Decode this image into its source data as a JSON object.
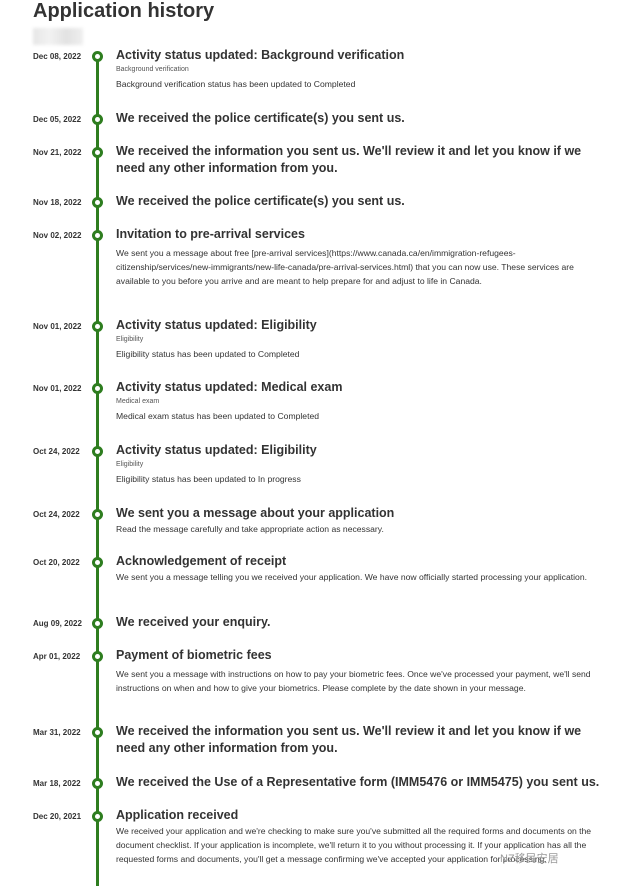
{
  "page": {
    "title": "Application history",
    "watermark": "NZ移民安居"
  },
  "colors": {
    "accent": "#2e7d1f",
    "text": "#333333"
  },
  "events": [
    {
      "date": "Dec 08, 2022",
      "title": "Activity status updated: Background verification",
      "subtitle": "Background verification",
      "description": "Background verification status has been updated to Completed"
    },
    {
      "date": "Dec 05, 2022",
      "title": "We received the police certificate(s) you sent us.",
      "subtitle": "",
      "description": ""
    },
    {
      "date": "Nov 21, 2022",
      "title": "We received the information you sent us. We'll review it and let you know if we need any other information from you.",
      "subtitle": "",
      "description": ""
    },
    {
      "date": "Nov 18, 2022",
      "title": "We received the police certificate(s) you sent us.",
      "subtitle": "",
      "description": ""
    },
    {
      "date": "Nov 02, 2022",
      "title": "Invitation to pre-arrival services",
      "subtitle": "",
      "description": "We sent you a message about free [pre-arrival services](https://www.canada.ca/en/immigration-refugees-citizenship/services/new-immigrants/new-life-canada/pre-arrival-services.html) that you can now use. These services are available to you before you arrive and are meant to help prepare for and adjust to life in Canada."
    },
    {
      "date": "Nov 01, 2022",
      "title": "Activity status updated: Eligibility",
      "subtitle": "Eligibility",
      "description": "Eligibility status has been updated to Completed"
    },
    {
      "date": "Nov 01, 2022",
      "title": "Activity status updated: Medical exam",
      "subtitle": "Medical exam",
      "description": "Medical exam status has been updated to Completed"
    },
    {
      "date": "Oct 24, 2022",
      "title": "Activity status updated: Eligibility",
      "subtitle": "Eligibility",
      "description": "Eligibility status has been updated to In progress"
    },
    {
      "date": "Oct 24, 2022",
      "title": "We sent you a message about your application",
      "subtitle": "",
      "description": "Read the message carefully and take appropriate action as necessary."
    },
    {
      "date": "Oct 20, 2022",
      "title": "Acknowledgement of receipt",
      "subtitle": "",
      "description": "We sent you a message telling you we received your application. We have now officially started processing your application."
    },
    {
      "date": "Aug 09, 2022",
      "title": "We received your enquiry.",
      "subtitle": "",
      "description": ""
    },
    {
      "date": "Apr 01, 2022",
      "title": "Payment of biometric fees",
      "subtitle": "",
      "description": "We sent you a message with instructions on how to pay your biometric fees. Once we've processed your payment, we'll send instructions on when and how to give your biometrics. Please complete by the date shown in your message."
    },
    {
      "date": "Mar 31, 2022",
      "title": "We received the information you sent us. We'll review it and let you know if we need any other information from you.",
      "subtitle": "",
      "description": ""
    },
    {
      "date": "Mar 18, 2022",
      "title": "We received the Use of a Representative form (IMM5476 or IMM5475) you sent us.",
      "subtitle": "",
      "description": ""
    },
    {
      "date": "Dec 20, 2021",
      "title": "Application received",
      "subtitle": "",
      "description": "We received your application and we're checking to make sure you've submitted all the required forms and documents on the document checklist. If your application is incomplete, we'll return it to you without processing it. If your application has all the requested forms and documents, you'll get a message confirming we've accepted your application for processing."
    }
  ]
}
